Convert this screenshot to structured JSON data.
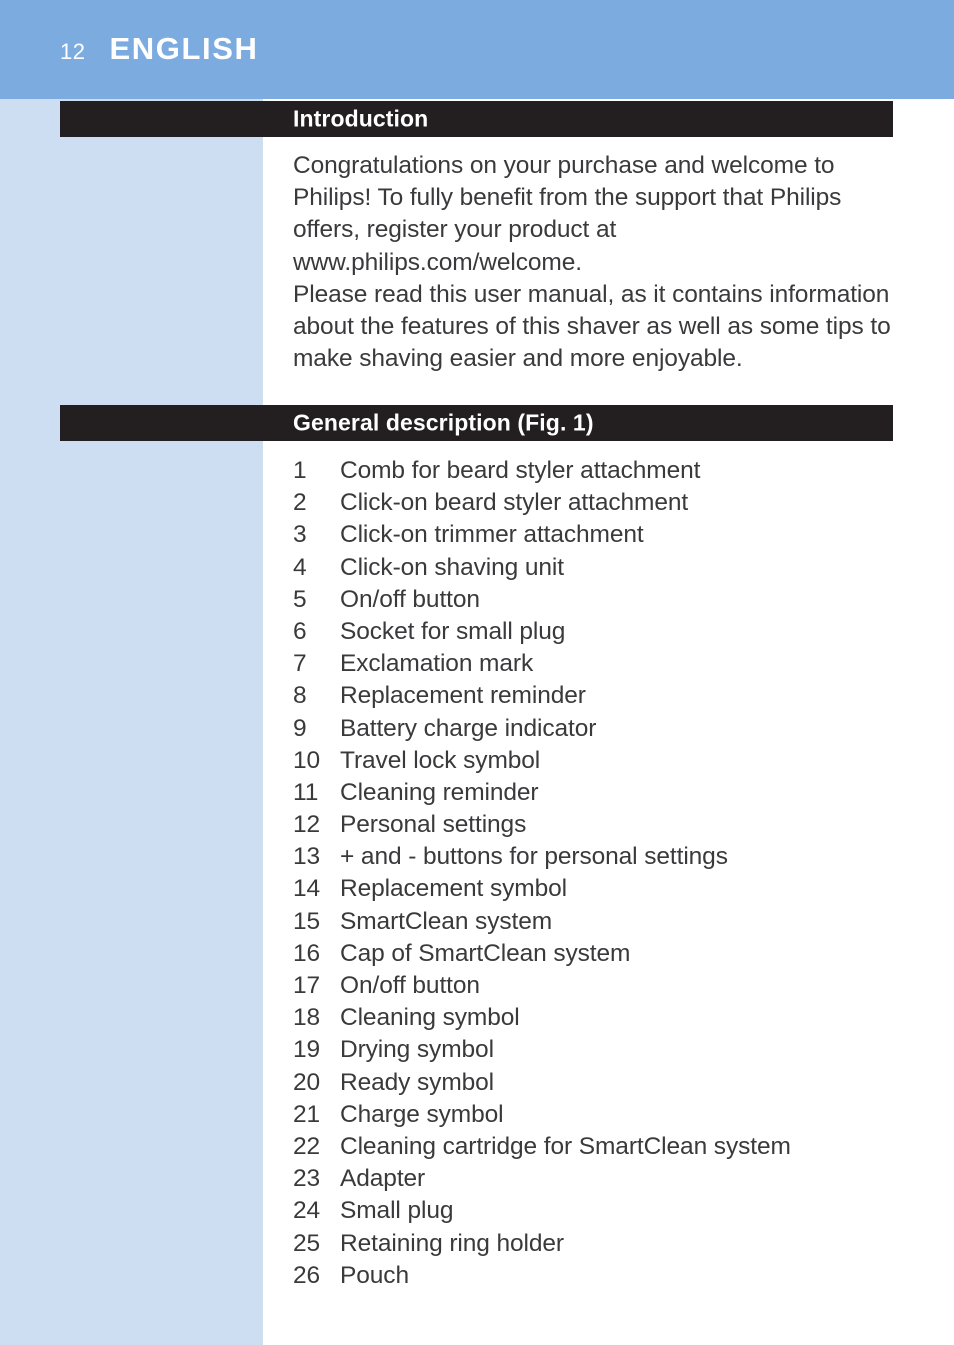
{
  "header": {
    "page_number": "12",
    "language": "ENGLISH",
    "band_color": "#7cabe0",
    "text_color": "#ffffff"
  },
  "margin": {
    "color": "#cddef3"
  },
  "sections": {
    "introduction": {
      "heading": "Introduction",
      "bar_color": "#231f20",
      "paragraphs": [
        "Congratulations on your purchase and welcome to Philips! To fully benefit from the support that Philips offers, register your product at www.philips.com/welcome.",
        "Please read this user manual, as it contains information about the features of this shaver as well as some tips to make shaving easier and more enjoyable."
      ]
    },
    "general_description": {
      "heading": "General description  (Fig. 1)",
      "bar_color": "#231f20",
      "items": [
        {
          "num": "1",
          "label": "Comb for beard styler attachment"
        },
        {
          "num": "2",
          "label": "Click-on beard styler attachment"
        },
        {
          "num": "3",
          "label": "Click-on trimmer attachment"
        },
        {
          "num": "4",
          "label": "Click-on shaving unit"
        },
        {
          "num": "5",
          "label": "On/off button"
        },
        {
          "num": "6",
          "label": "Socket for small plug"
        },
        {
          "num": "7",
          "label": "Exclamation mark"
        },
        {
          "num": "8",
          "label": "Replacement reminder"
        },
        {
          "num": "9",
          "label": "Battery charge indicator"
        },
        {
          "num": "10",
          "label": "Travel lock symbol"
        },
        {
          "num": "11",
          "label": "Cleaning reminder"
        },
        {
          "num": "12",
          "label": "Personal settings"
        },
        {
          "num": "13",
          "label": "+ and - buttons for personal settings"
        },
        {
          "num": "14",
          "label": "Replacement symbol"
        },
        {
          "num": "15",
          "label": "SmartClean system"
        },
        {
          "num": "16",
          "label": "Cap of SmartClean system"
        },
        {
          "num": "17",
          "label": "On/off button"
        },
        {
          "num": "18",
          "label": "Cleaning symbol"
        },
        {
          "num": "19",
          "label": "Drying symbol"
        },
        {
          "num": "20",
          "label": "Ready symbol"
        },
        {
          "num": "21",
          "label": "Charge symbol"
        },
        {
          "num": "22",
          "label": "Cleaning cartridge for SmartClean system"
        },
        {
          "num": "23",
          "label": "Adapter"
        },
        {
          "num": "24",
          "label": "Small plug"
        },
        {
          "num": "25",
          "label": "Retaining ring holder"
        },
        {
          "num": "26",
          "label": "Pouch"
        }
      ]
    }
  }
}
